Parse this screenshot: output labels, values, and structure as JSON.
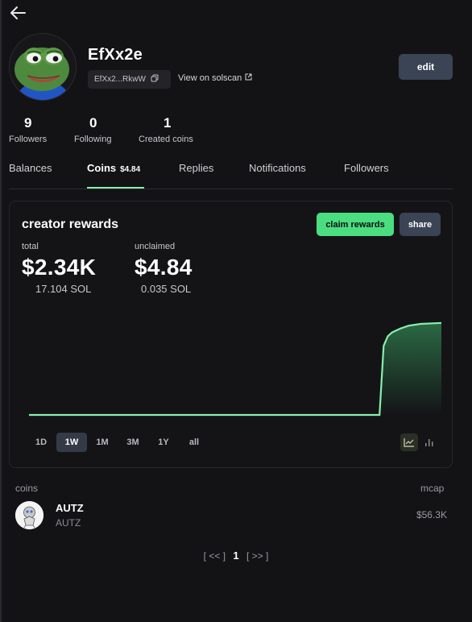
{
  "profile": {
    "username": "EfXx2e",
    "address_short": "EfXx2...RkwW",
    "solscan_label": "View on solscan",
    "edit_label": "edit"
  },
  "stats": [
    {
      "value": "9",
      "label": "Followers"
    },
    {
      "value": "0",
      "label": "Following"
    },
    {
      "value": "1",
      "label": "Created coins"
    }
  ],
  "tabs": {
    "balances": "Balances",
    "coins": "Coins",
    "coins_badge": "$4.84",
    "replies": "Replies",
    "notifications": "Notifications",
    "followers": "Followers"
  },
  "rewards": {
    "title": "creator rewards",
    "claim_label": "claim rewards",
    "share_label": "share",
    "total_label": "total",
    "total_usd": "$2.34K",
    "total_sol": "17.104 SOL",
    "unclaimed_label": "unclaimed",
    "unclaimed_usd": "$4.84",
    "unclaimed_sol": "0.035 SOL",
    "ranges": [
      "1D",
      "1W",
      "1M",
      "3M",
      "1Y",
      "all"
    ],
    "active_range": "1W",
    "accent_color": "#86efac"
  },
  "chart_data": {
    "type": "area",
    "x": [
      0,
      10,
      20,
      30,
      40,
      50,
      60,
      70,
      80,
      85,
      86,
      87,
      88,
      89,
      90,
      92,
      95,
      100
    ],
    "y": [
      0,
      0,
      0,
      0,
      0,
      0,
      0,
      0,
      0,
      0,
      0.72,
      0.82,
      0.86,
      0.88,
      0.9,
      0.93,
      0.95,
      0.96
    ],
    "title": "",
    "xlabel": "",
    "ylabel": "",
    "grid": false
  },
  "coins": {
    "header_left": "coins",
    "header_right": "mcap",
    "items": [
      {
        "name": "AUTZ",
        "ticker": "AUTZ",
        "mcap": "$56.3K"
      }
    ]
  },
  "pagination": {
    "prev": "[ <<  ]",
    "current": "1",
    "next": "[ >> ]"
  },
  "icons": {
    "back": "arrow-left-icon",
    "copy": "copy-icon",
    "external": "external-link-icon",
    "line_chart": "line-chart-icon",
    "bar_chart": "bar-chart-icon"
  }
}
